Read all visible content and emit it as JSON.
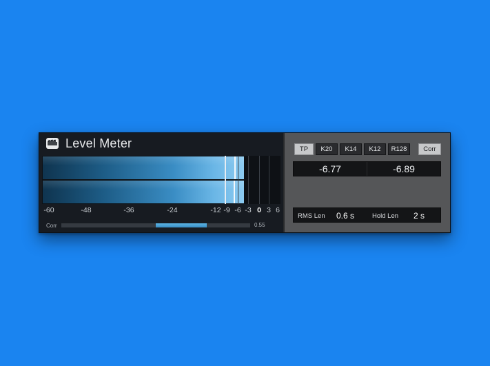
{
  "plugin": {
    "title": "Level Meter"
  },
  "meter": {
    "left_channel": {
      "rms_db": -4.2,
      "peak_db": -6.77
    },
    "right_channel": {
      "rms_db": -4.2,
      "peak_db": -6.89
    },
    "scale_min_db": -60,
    "scale_max_db": 6,
    "rms_marker_db": -24,
    "ticks": [
      "-60",
      "-48",
      "-36",
      "-24",
      "-12",
      "-9",
      "-6",
      "-3",
      "0",
      "3",
      "6"
    ],
    "grid_db": [
      -6,
      -3,
      0,
      3
    ]
  },
  "correlation": {
    "label": "Corr",
    "value_text": "0.55",
    "fill_start": 0.5,
    "fill_end": 0.77
  },
  "modes": [
    {
      "label": "TP",
      "active": true
    },
    {
      "label": "K20",
      "active": false
    },
    {
      "label": "K14",
      "active": false
    },
    {
      "label": "K12",
      "active": false
    },
    {
      "label": "R128",
      "active": false
    }
  ],
  "corr_button": {
    "label": "Corr"
  },
  "peak_values": {
    "left": "-6.77",
    "right": "-6.89"
  },
  "lengths": {
    "rms_label": "RMS Len",
    "rms_value": "0.6 s",
    "hold_label": "Hold Len",
    "hold_value": "2 s"
  },
  "colors": {
    "background": "#1a84f0",
    "meter_accent": "#6ab6e6"
  }
}
